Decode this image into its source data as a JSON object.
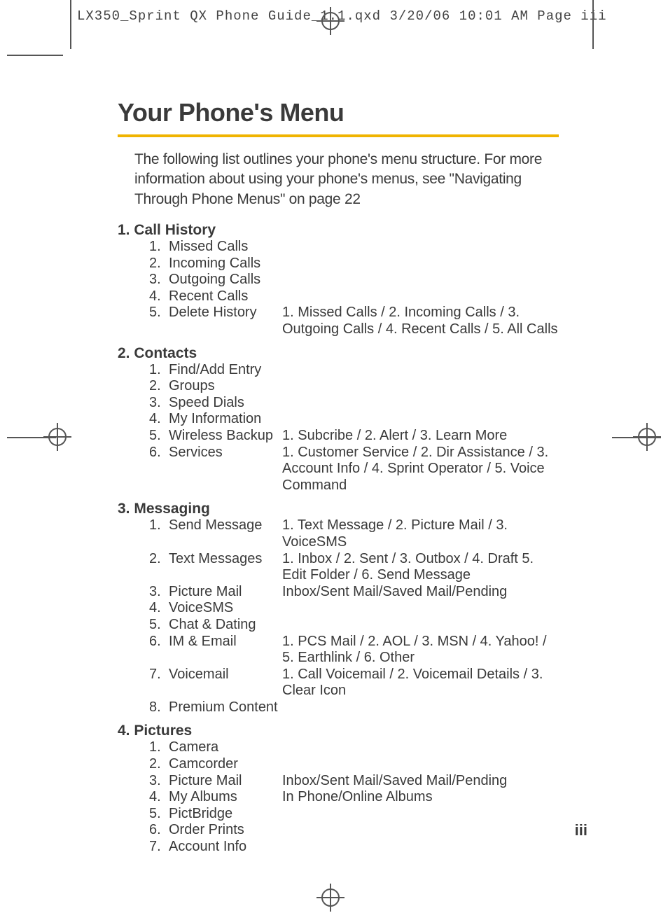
{
  "header": "LX350_Sprint QX Phone Guide_1.1.qxd  3/20/06  10:01 AM  Page iii",
  "title": "Your Phone's Menu",
  "intro": "The following list outlines your phone's menu structure. For more information about using your phone's menus, see \"Navigating Through Phone Menus\" on page 22",
  "page_number": "iii",
  "sections": [
    {
      "n": "1.",
      "title": "Call History",
      "items": [
        {
          "n": "1.",
          "label": "Missed Calls",
          "right": ""
        },
        {
          "n": "2.",
          "label": "Incoming Calls",
          "right": ""
        },
        {
          "n": "3.",
          "label": "Outgoing Calls",
          "right": ""
        },
        {
          "n": "4.",
          "label": "Recent Calls",
          "right": ""
        },
        {
          "n": "5.",
          "label": "Delete History",
          "right": "1. Missed Calls / 2. Incoming Calls / 3. Outgoing Calls / 4. Recent Calls / 5. All Calls"
        }
      ]
    },
    {
      "n": "2.",
      "title": "Contacts",
      "items": [
        {
          "n": "1.",
          "label": "Find/Add  Entry",
          "right": ""
        },
        {
          "n": "2.",
          "label": "Groups",
          "right": ""
        },
        {
          "n": "3.",
          "label": "Speed Dials",
          "right": ""
        },
        {
          "n": "4.",
          "label": "My Information",
          "right": ""
        },
        {
          "n": "5.",
          "label": "Wireless Backup",
          "right": "1. Subcribe / 2. Alert / 3. Learn More"
        },
        {
          "n": "6.",
          "label": "Services",
          "right": "1. Customer Service / 2. Dir Assistance / 3. Account Info / 4. Sprint Operator / 5. Voice Command"
        }
      ]
    },
    {
      "n": "3.",
      "title": "Messaging",
      "items": [
        {
          "n": "1.",
          "label": "Send Message",
          "right": "1. Text Message / 2. Picture Mail / 3. VoiceSMS"
        },
        {
          "n": "2.",
          "label": "Text Messages",
          "right": "1. Inbox / 2. Sent / 3. Outbox / 4. Draft 5. Edit Folder / 6. Send Message"
        },
        {
          "n": "3.",
          "label": "Picture Mail",
          "right": "Inbox/Sent Mail/Saved Mail/Pending"
        },
        {
          "n": "4.",
          "label": "VoiceSMS",
          "right": ""
        },
        {
          "n": "5.",
          "label": "Chat & Dating",
          "right": ""
        },
        {
          "n": "6.",
          "label": "IM & Email",
          "right": "1. PCS Mail / 2. AOL / 3. MSN / 4. Yahoo! / 5. Earthlink / 6. Other"
        },
        {
          "n": "7.",
          "label": "Voicemail",
          "right": "1. Call Voicemail / 2. Voicemail Details / 3. Clear Icon"
        },
        {
          "n": "8.",
          "label": "Premium Content",
          "right": ""
        }
      ]
    },
    {
      "n": "4.",
      "title": "Pictures",
      "items": [
        {
          "n": "1.",
          "label": "Camera",
          "right": ""
        },
        {
          "n": "2.",
          "label": "Camcorder",
          "right": ""
        },
        {
          "n": "3.",
          "label": "Picture Mail",
          "right": "Inbox/Sent Mail/Saved Mail/Pending"
        },
        {
          "n": "4.",
          "label": "My Albums",
          "right": "In Phone/Online Albums"
        },
        {
          "n": "5.",
          "label": "PictBridge",
          "right": ""
        },
        {
          "n": "6.",
          "label": "Order Prints",
          "right": ""
        },
        {
          "n": "7.",
          "label": "Account Info",
          "right": ""
        }
      ]
    }
  ]
}
